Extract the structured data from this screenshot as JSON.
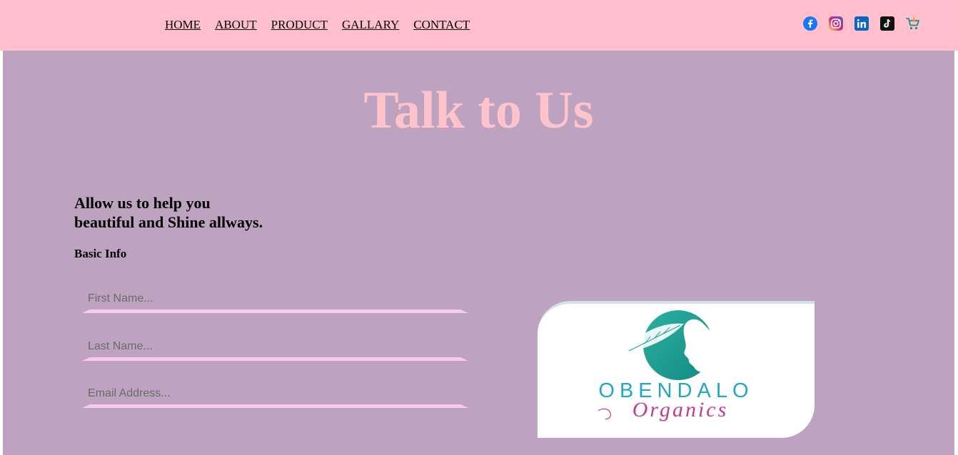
{
  "nav": {
    "links": [
      "HOME",
      "ABOUT",
      "PRODUCT",
      "GALLARY",
      "CONTACT"
    ],
    "icons": [
      "facebook-icon",
      "instagram-icon",
      "linkedin-icon",
      "tiktok-icon",
      "cart-icon"
    ]
  },
  "hero": {
    "title": "Talk to Us"
  },
  "intro": {
    "line1": "Allow us to help you",
    "line2": "beautiful and Shine allways."
  },
  "form": {
    "section_title": "Basic Info",
    "first_name_placeholder": "First Name...",
    "last_name_placeholder": "Last Name...",
    "email_placeholder": "Email Address..."
  },
  "logo": {
    "brand": "OBENDALO",
    "sub": "Organics"
  },
  "colors": {
    "nav_bg": "#ffbfcc",
    "main_bg": "#bda3bf",
    "title": "#ffc3cb",
    "underline": "#f6cbf2",
    "logo_teal": "#1fa89a",
    "logo_magenta": "#c23c8e"
  }
}
